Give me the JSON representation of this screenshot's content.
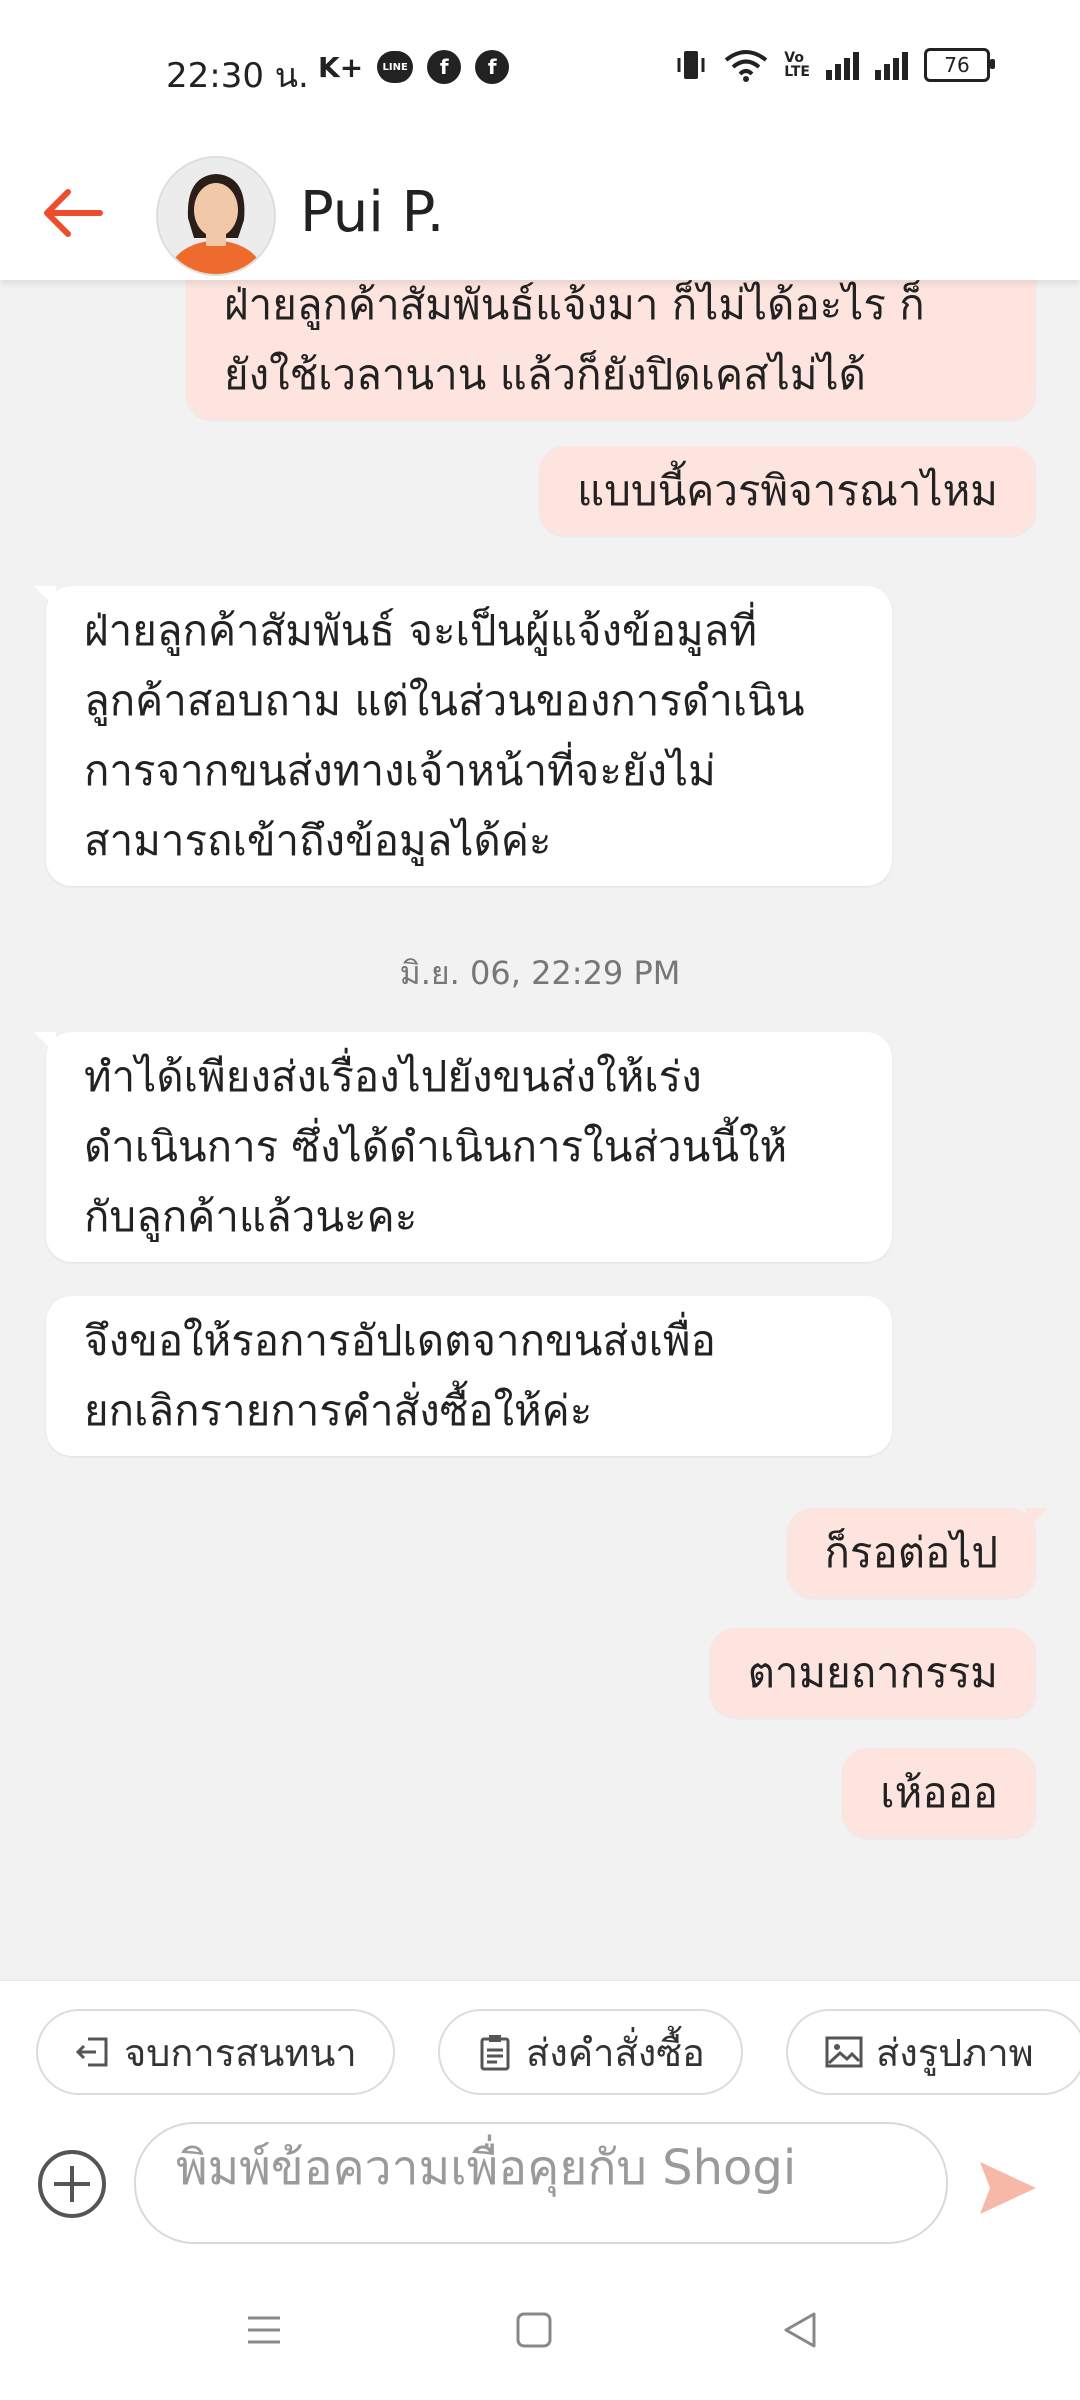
{
  "status_bar": {
    "time": "22:30 น.",
    "kplus": "K+",
    "line": "LINE",
    "battery": "76"
  },
  "header": {
    "contact_name": "Pui P."
  },
  "messages": [
    {
      "side": "out",
      "text_line1": "ฝ่ายลูกค้าสัมพันธ์แจ้งมา ก็ไม่ได้อะไร ก็",
      "text_line2": "ยังใช้เวลานาน แล้วก็ยังปิดเคสไม่ได้"
    },
    {
      "side": "out",
      "text": "แบบนี้ควรพิจารณาไหม"
    },
    {
      "side": "in",
      "lines": [
        "ฝ่ายลูกค้าสัมพันธ์ จะเป็นผู้แจ้งข้อมูลที่",
        "ลูกค้าสอบถาม แต่ในส่วนของการดำเนิน",
        "การจากขนส่งทางเจ้าหน้าที่จะยังไม่",
        "สามารถเข้าถึงข้อมูลได้ค่ะ"
      ]
    },
    {
      "side": "in",
      "lines": [
        "ทำได้เพียงส่งเรื่องไปยังขนส่งให้เร่ง",
        "ดำเนินการ ซึ่งได้ดำเนินการในส่วนนี้ให้",
        "กับลูกค้าแล้วนะคะ"
      ]
    },
    {
      "side": "in",
      "lines": [
        "จึงขอให้รอการอัปเดตจากขนส่งเพื่อ",
        "ยกเลิกรายการคำสั่งซื้อให้ค่ะ"
      ]
    },
    {
      "side": "out",
      "text": "ก็รอต่อไป"
    },
    {
      "side": "out",
      "text": "ตามยถากรรม"
    },
    {
      "side": "out",
      "text": "เห้อออ"
    }
  ],
  "timestamp": "มิ.ย. 06, 22:29 PM",
  "quick_actions": [
    {
      "label": "จบการสนทนา",
      "icon": "exit-icon"
    },
    {
      "label": "ส่งคำสั่งซื้อ",
      "icon": "clipboard-icon"
    },
    {
      "label": "ส่งรูปภาพ",
      "icon": "image-icon"
    }
  ],
  "input": {
    "placeholder": "พิมพ์ข้อความเพื่อคุยกับ Shogi"
  },
  "colors": {
    "accent": "#ee4d2d",
    "outgoing_bubble": "#fde4df",
    "incoming_bubble": "#ffffff",
    "background": "#f2f2f2"
  }
}
